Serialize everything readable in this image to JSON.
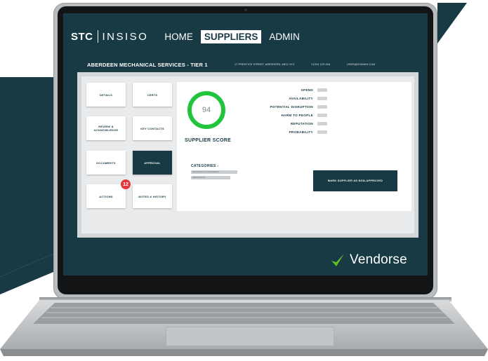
{
  "nav": {
    "brand_primary": "STC",
    "brand_secondary": "INSISO",
    "items": [
      {
        "label": "HOME",
        "active": false
      },
      {
        "label": "SUPPLIERS",
        "active": true
      },
      {
        "label": "ADMIN",
        "active": false
      }
    ]
  },
  "supplier": {
    "title": "ABERDEEN MECHANICAL SERVICES - TIER 1",
    "address": "17 PRENTICE STREET, ABERDEEN, AB12 3YX",
    "phone": "01224 123 456",
    "email": "USER@DOMAIN.COM"
  },
  "tiles": [
    {
      "label": "DETAILS"
    },
    {
      "label": "CERTS"
    },
    {
      "label": "REVIEW & ACKNOWLEDGE"
    },
    {
      "label": "KEY CONTACTS"
    },
    {
      "label": "DOCUMENTS"
    },
    {
      "label": "APPROVAL"
    },
    {
      "label": "ACTIONS"
    },
    {
      "label": "NOTES & HISTORY"
    }
  ],
  "actions_badge": "12",
  "score": {
    "value": "94",
    "label": "SUPPLIER SCORE"
  },
  "metrics": [
    {
      "label": "SPEND"
    },
    {
      "label": "AVAILABILITY"
    },
    {
      "label": "POTENTIAL DISRUPTION"
    },
    {
      "label": "HARM TO PEOPLE"
    },
    {
      "label": "REPUTATION"
    },
    {
      "label": "PROBABILITY"
    }
  ],
  "categories": {
    "label": "CATEGORIES -",
    "chips": [
      "MECHANICAL ENGINEERING",
      "FABRICATION"
    ]
  },
  "cta_label": "MARK SUPPLIER AS NON-APPROVED",
  "footer_brand": "Vendorse",
  "colors": {
    "primary": "#183a44",
    "score_ring": "#22c43c",
    "badge": "#e5383b",
    "check": "#5fbf2a"
  }
}
